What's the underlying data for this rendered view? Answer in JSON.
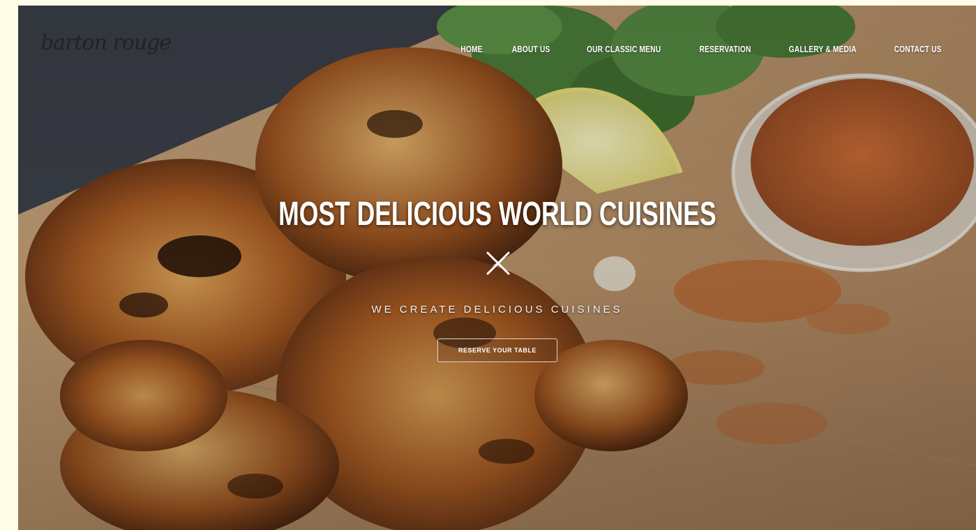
{
  "brand": {
    "logo_text": "barton rouge"
  },
  "nav": {
    "items": [
      {
        "label": "HOME"
      },
      {
        "label": "ABOUT US"
      },
      {
        "label": "OUR CLASSIC MENU"
      },
      {
        "label": "RESERVATION"
      },
      {
        "label": "GALLERY & MEDIA"
      },
      {
        "label": "CONTACT US"
      }
    ]
  },
  "hero": {
    "headline": "MOST DELICIOUS WORLD CUISINES",
    "divider_icon": "x-mark-icon",
    "tagline": "WE CREATE DELICIOUS CUISINES",
    "cta_label": "RESERVE YOUR TABLE"
  },
  "colors": {
    "page_background": "#fffde8",
    "text": "#ffffff",
    "button_border": "#e3d6c6"
  }
}
